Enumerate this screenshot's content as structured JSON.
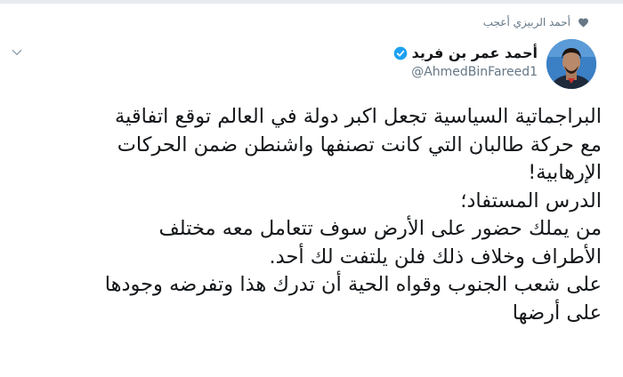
{
  "social_context": {
    "text": "أحمد الربيزي أعجب",
    "icon": "heart-icon"
  },
  "author": {
    "name": "أحمد عمر بن فريد",
    "handle": "@AhmedBinFareed1",
    "verified": true,
    "verified_color": "#1da1f2"
  },
  "tweet": {
    "lines": [
      "البراجماتية السياسية تجعل اكبر دولة في العالم توقع اتفاقية",
      "مع حركة طالبان التي كانت تصنفها واشنطن ضمن الحركات",
      "الإرهابية!",
      "الدرس المستفاد؛",
      "من يملك حضور على الأرض سوف تتعامل معه مختلف",
      "الأطراف وخلاف ذلك فلن يلتفت لك أحد.",
      "على شعب الجنوب وقواه الحية أن تدرك هذا وتفرضه وجودها",
      "على أرضها"
    ]
  },
  "colors": {
    "text": "#14171a",
    "secondary": "#657786",
    "accent": "#1da1f2"
  }
}
